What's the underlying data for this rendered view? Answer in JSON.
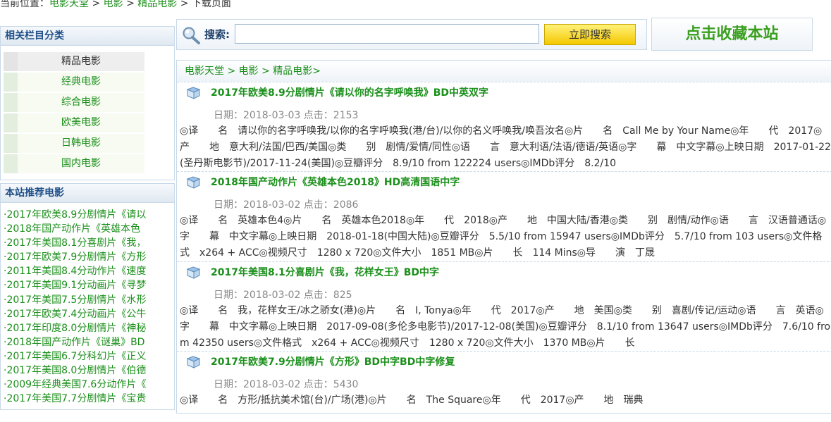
{
  "breadcrumb_top": {
    "prefix": "当前位置：",
    "home": "电影天堂",
    "sep1": " > ",
    "movies": "电影",
    "sep2": " > ",
    "category": "精品电影",
    "sep3": " > ",
    "page": "下载页面"
  },
  "sidebar": {
    "categories_title": "相关栏目分类",
    "categories": [
      "精品电影",
      "经典电影",
      "综合电影",
      "欧美电影",
      "日韩电影",
      "国内电影"
    ],
    "recommend_title": "本站推荐电影",
    "recommend": [
      "·2017年欧美8.9分剧情片《请以",
      "·2018年国产动作片《英雄本色",
      "·2017年美国8.1分喜剧片《我，",
      "·2017年欧美7.9分剧情片《方形",
      "·2011年美国8.4分动作片《速度",
      "·2017年美国9.1分动画片《寻梦",
      "·2017年美国7.5分剧情片《水形",
      "·2017年欧美7.4分动画片《公牛",
      "·2017年印度8.0分剧情片《神秘",
      "·2018年国产动作片《谜巢》BD",
      "·2017年美国6.7分科幻片《正义",
      "·2017年美国8.0分剧情片《伯德",
      "·2009年经典美国7.6分动作片《",
      "·2017年美国7.7分剧情片《宝贵"
    ]
  },
  "search": {
    "label": "搜索:",
    "placeholder": "",
    "button": "立即搜索"
  },
  "favorite": {
    "label": "点击收藏本站"
  },
  "main": {
    "breadcrumb": "电影天堂 > 电影 > 精品电影>",
    "items": [
      {
        "title": "2017年欧美8.9分剧情片《请以你的名字呼唤我》BD中英双字",
        "date": "日期：2018-03-03 点击：2153",
        "desc": "◎译　　名　请以你的名字呼唤我/以你的名字呼唤我(港/台)/以你的名义呼唤我/唤吾汝名◎片　　名　Call Me by Your Name◎年　　代　2017◎产　　地　意大利/法国/巴西/美国◎类　　别　剧情/爱情/同性◎语　　言　意大利语/法语/德语/英语◎字　　幕　中文字幕◎上映日期　2017-01-22(圣丹斯电影节)/2017-11-24(美国)◎豆瓣评分　8.9/10 from 122224 users◎IMDb评分　8.2/10"
      },
      {
        "title": "2018年国产动作片《英雄本色2018》HD高清国语中字",
        "date": "日期：2018-03-02 点击：2086",
        "desc": "◎译　　名　英雄本色4◎片　　名　英雄本色2018◎年　　代　2018◎产　　地　中国大陆/香港◎类　　别　剧情/动作◎语　　言　汉语普通话◎字　　幕　中文字幕◎上映日期　2018-01-18(中国大陆)◎豆瓣评分　5.5/10 from 15947 users◎IMDb评分　5.7/10 from 103 users◎文件格式　x264 + ACC◎视频尺寸　1280 x 720◎文件大小　1851 MB◎片　　长　114 Mins◎导　　演　丁晟"
      },
      {
        "title": "2017年美国8.1分喜剧片《我，花样女王》BD中字",
        "date": "日期：2018-03-02 点击：825",
        "desc": "◎译　　名　我，花样女王/冰之骄女(港)◎片　　名　I, Tonya◎年　　代　2017◎产　　地　美国◎类　　别　喜剧/传记/运动◎语　　言　英语◎字　　幕　中文字幕◎上映日期　2017-09-08(多伦多电影节)/2017-12-08(美国)◎豆瓣评分　8.1/10 from 13647 users◎IMDb评分　7.6/10 from 42350 users◎文件格式　x264 + ACC◎视频尺寸　1280 x 720◎文件大小　1370 MB◎片　　长"
      },
      {
        "title": "2017年欧美7.9分剧情片《方形》BD中字BD中字修复",
        "date": "日期：2018-03-02 点击：5430",
        "desc": "◎译　　名　方形/抵抗美术馆(台)/广场(港)◎片　　名　The Square◎年　　代　2017◎产　　地　瑞典"
      }
    ]
  }
}
